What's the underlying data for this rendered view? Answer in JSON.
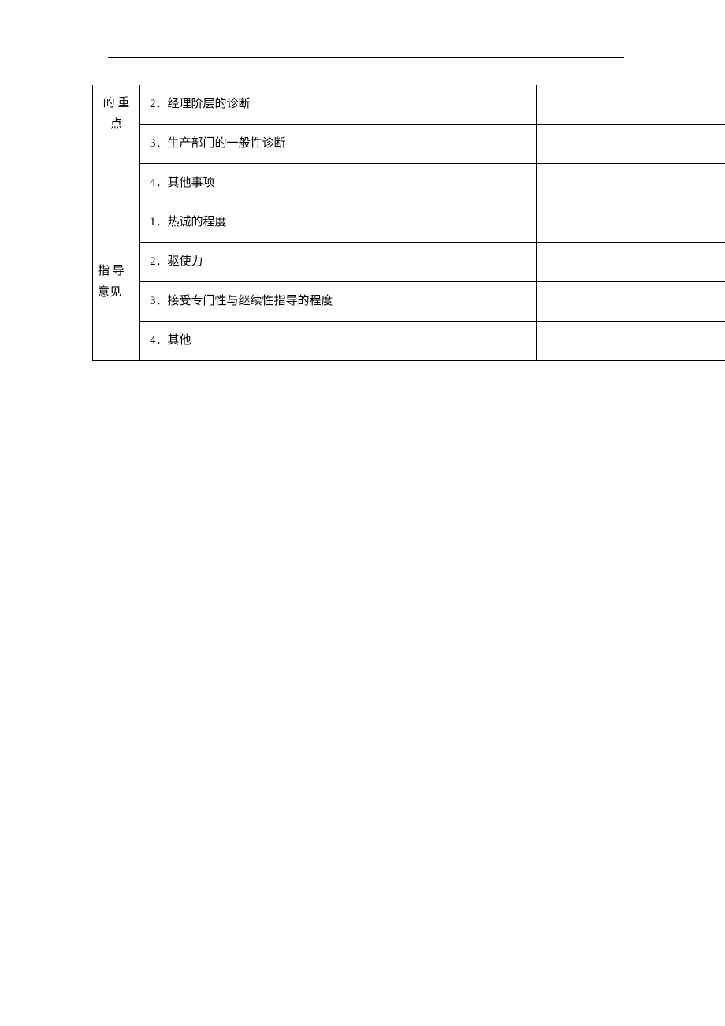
{
  "sections": [
    {
      "label": "的 重点",
      "items": [
        "2．经理阶层的诊断",
        "3．生产部门的一般性诊断",
        "4．其他事项"
      ]
    },
    {
      "label": "指 导意见",
      "items": [
        "1．热诚的程度",
        "2．驱使力",
        "3．接受专门性与继续性指导的程度",
        "4．其他"
      ]
    }
  ]
}
